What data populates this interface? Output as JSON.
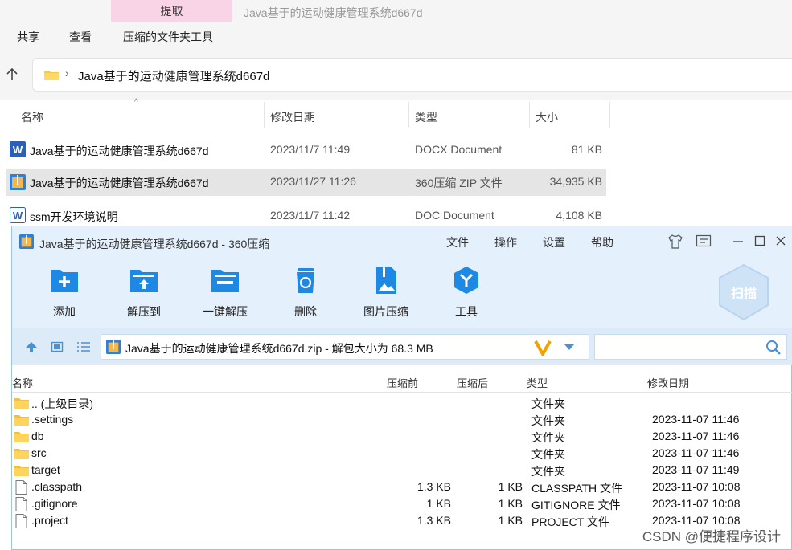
{
  "explorer": {
    "context_tab": "提取",
    "title": "Java基于的运动健康管理系统d667d",
    "menu": [
      "共享",
      "查看",
      "压缩的文件夹工具"
    ],
    "address": "Java基于的运动健康管理系统d667d",
    "columns": [
      "名称",
      "修改日期",
      "类型",
      "大小"
    ],
    "files": [
      {
        "icon": "word-docx-icon",
        "name": "Java基于的运动健康管理系统d667d",
        "date": "2023/11/7 11:49",
        "type": "DOCX Document",
        "size": "81 KB"
      },
      {
        "icon": "zip-archive-icon",
        "name": "Java基于的运动健康管理系统d667d",
        "date": "2023/11/27 11:26",
        "type": "360压缩 ZIP 文件",
        "size": "34,935 KB"
      },
      {
        "icon": "word-doc-icon",
        "name": "ssm开发环境说明",
        "date": "2023/11/7 11:42",
        "type": "DOC Document",
        "size": "4,108 KB"
      }
    ]
  },
  "zip": {
    "title": "Java基于的运动健康管理系统d667d - 360压缩",
    "menu": [
      "文件",
      "操作",
      "设置",
      "帮助"
    ],
    "toolbar": [
      "添加",
      "解压到",
      "一键解压",
      "删除",
      "图片压缩",
      "工具"
    ],
    "scan_label": "扫描",
    "address": "Java基于的运动健康管理系统d667d.zip - 解包大小为 68.3 MB",
    "columns": [
      "名称",
      "压缩前",
      "压缩后",
      "类型",
      "修改日期"
    ],
    "rows": [
      {
        "icon": "folder-icon",
        "name": ".. (上级目录)",
        "before": "",
        "after": "",
        "type": "文件夹",
        "date": ""
      },
      {
        "icon": "folder-icon",
        "name": ".settings",
        "before": "",
        "after": "",
        "type": "文件夹",
        "date": "2023-11-07 11:46"
      },
      {
        "icon": "folder-icon",
        "name": "db",
        "before": "",
        "after": "",
        "type": "文件夹",
        "date": "2023-11-07 11:46"
      },
      {
        "icon": "folder-icon",
        "name": "src",
        "before": "",
        "after": "",
        "type": "文件夹",
        "date": "2023-11-07 11:46"
      },
      {
        "icon": "folder-icon",
        "name": "target",
        "before": "",
        "after": "",
        "type": "文件夹",
        "date": "2023-11-07 11:49"
      },
      {
        "icon": "file-icon",
        "name": ".classpath",
        "before": "1.3 KB",
        "after": "1 KB",
        "type": "CLASSPATH 文件",
        "date": "2023-11-07 10:08"
      },
      {
        "icon": "file-icon",
        "name": ".gitignore",
        "before": "1 KB",
        "after": "1 KB",
        "type": "GITIGNORE 文件",
        "date": "2023-11-07 10:08"
      },
      {
        "icon": "file-icon",
        "name": ".project",
        "before": "1.3 KB",
        "after": "1 KB",
        "type": "PROJECT 文件",
        "date": "2023-11-07 10:08"
      }
    ]
  },
  "watermark": "CSDN @便捷程序设计",
  "colors": {
    "accent_blue": "#1e88e5",
    "selected_row": "#e5e5e5",
    "extract_tab": "#f9d4e6",
    "zip_toolbar": "#e4f0fc"
  }
}
